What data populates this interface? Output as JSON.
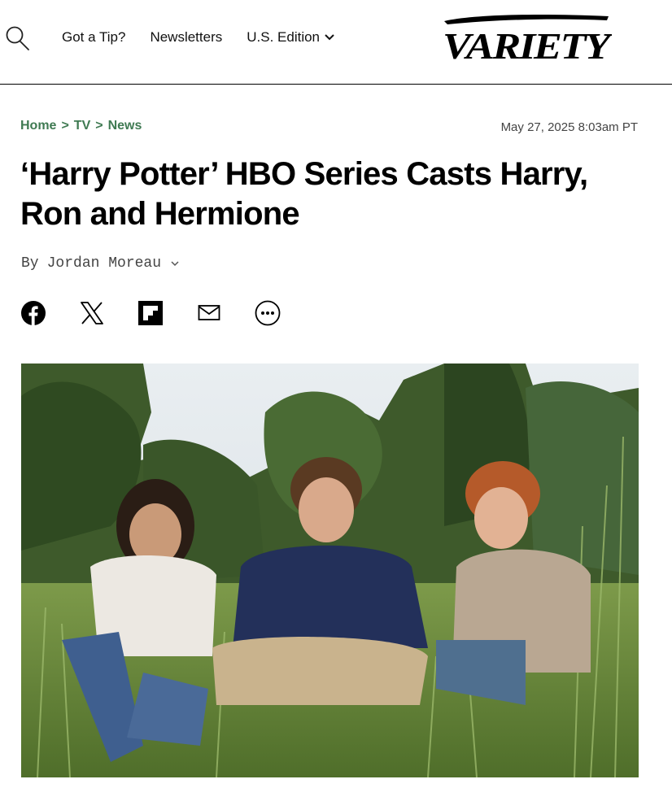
{
  "header": {
    "nav": {
      "tip_label": "Got a Tip?",
      "newsletters_label": "Newsletters",
      "edition_label": "U.S. Edition"
    },
    "logo_text": "VARIETY",
    "icons": {
      "search": "search-icon",
      "edition": "chevron-down-icon"
    }
  },
  "breadcrumb": {
    "home": "Home",
    "separator": ">",
    "section": "TV",
    "subsection": "News"
  },
  "article": {
    "date": "May 27, 2025 8:03am PT",
    "title": "‘Harry Potter’ HBO Series Casts Harry, Ron and Hermione",
    "byline_prefix": "By",
    "author": "Jordan Moreau"
  },
  "share": {
    "icons": [
      "facebook-icon",
      "x-icon",
      "flipboard-icon",
      "email-icon",
      "more-icon"
    ]
  },
  "hero_image": {
    "description_icon": "photo-image"
  },
  "colors": {
    "breadcrumb": "#3f7a52",
    "divider": "#000000",
    "text": "#000000",
    "muted": "#444444"
  }
}
